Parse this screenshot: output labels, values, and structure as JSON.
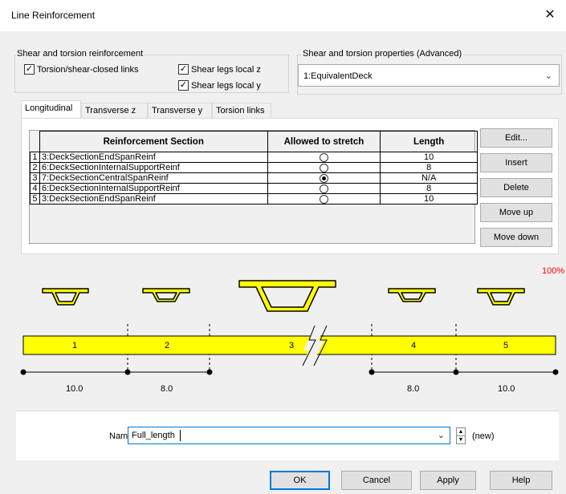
{
  "window": {
    "title": "Line Reinforcement",
    "close_glyph": "✕"
  },
  "shear_group": {
    "legend": "Shear and torsion reinforcement",
    "torsion_links": {
      "label": "Torsion/shear-closed links",
      "checked": true
    },
    "legs_z": {
      "label": "Shear legs local z",
      "checked": true
    },
    "legs_y": {
      "label": "Shear legs local y",
      "checked": true
    }
  },
  "props_group": {
    "legend": "Shear and torsion properties (Advanced)",
    "selected": "1:EquivalentDeck"
  },
  "tabs": [
    "Longitudinal",
    "Transverse z",
    "Transverse y",
    "Torsion links"
  ],
  "active_tab": 0,
  "table": {
    "headers": [
      "Reinforcement Section",
      "Allowed to stretch",
      "Length"
    ],
    "rows": [
      {
        "index": "1",
        "section": "3:DeckSectionEndSpanReinf",
        "stretch": false,
        "length": "10"
      },
      {
        "index": "2",
        "section": "6:DeckSectionInternalSupportReinf",
        "stretch": false,
        "length": "8"
      },
      {
        "index": "3",
        "section": "7:DeckSectionCentralSpanReinf",
        "stretch": true,
        "length": "N/A"
      },
      {
        "index": "4",
        "section": "6:DeckSectionInternalSupportReinf",
        "stretch": false,
        "length": "8"
      },
      {
        "index": "5",
        "section": "3:DeckSectionEndSpanReinf",
        "stretch": false,
        "length": "10"
      }
    ]
  },
  "side_buttons": {
    "edit": "Edit...",
    "insert": "Insert",
    "delete": "Delete",
    "move_up": "Move up",
    "move_down": "Move down"
  },
  "preview": {
    "zoom": "100%",
    "segments": [
      "1",
      "2",
      "3",
      "4",
      "5"
    ],
    "dimensions": [
      "10.0",
      "8.0",
      "8.0",
      "10.0"
    ],
    "bar_color": "#ffff00",
    "section_color": "#ffff00"
  },
  "name_row": {
    "label": "Name",
    "value": "Full_length",
    "status": "(new)"
  },
  "footer": {
    "ok": "OK",
    "cancel": "Cancel",
    "apply": "Apply",
    "help": "Help"
  }
}
